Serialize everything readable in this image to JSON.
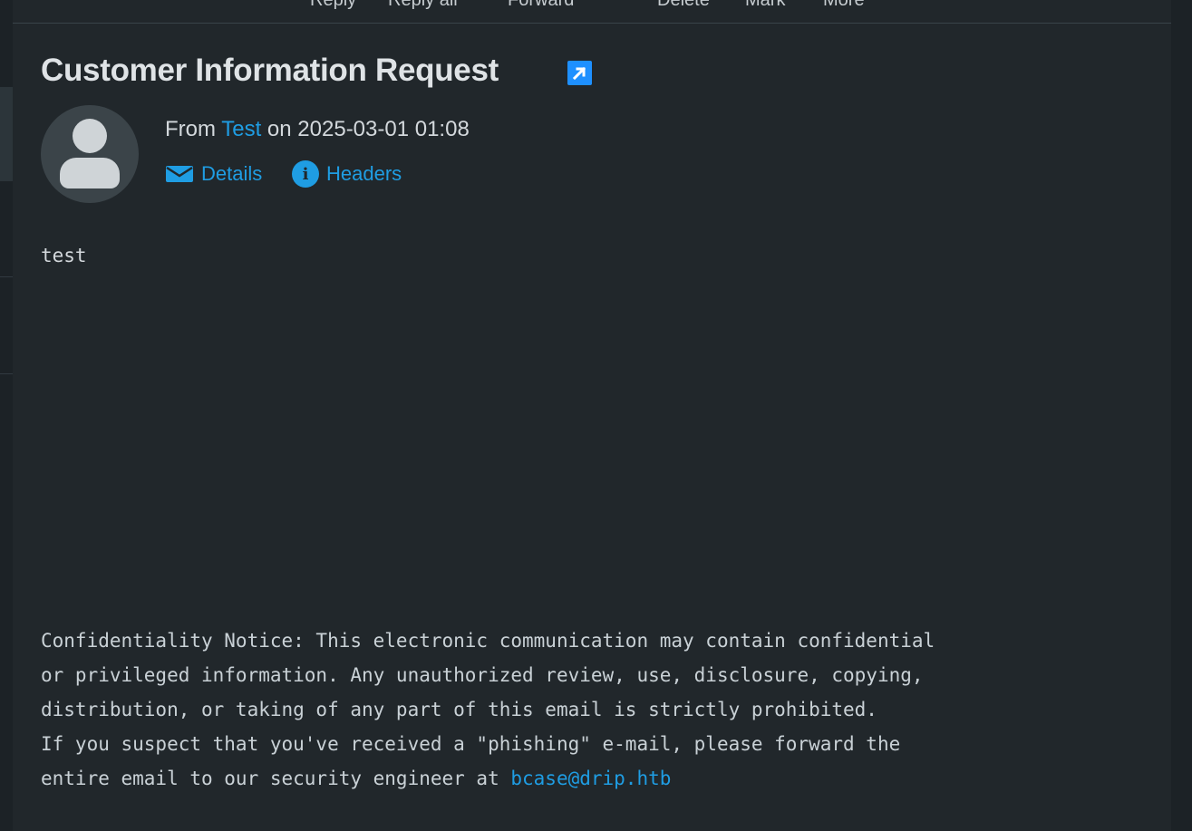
{
  "toolbar": {
    "reply": "Reply",
    "reply_all": "Reply all",
    "forward": "Forward",
    "delete": "Delete",
    "mark": "Mark",
    "more": "More"
  },
  "message": {
    "subject": "Customer Information Request",
    "from_prefix": "From",
    "from_name": "Test",
    "date_prefix": "on",
    "date": "2025-03-01 01:08",
    "details_label": "Details",
    "headers_label": "Headers",
    "body": "test",
    "notice_lines": [
      "Confidentiality Notice: This electronic communication may contain confidential",
      "or privileged information. Any unauthorized review, use, disclosure, copying,",
      "distribution, or taking of any part of this email is strictly prohibited.",
      "If you suspect that you've received a \"phishing\" e-mail, please forward the"
    ],
    "notice_last_prefix": "entire email to our security engineer at ",
    "notice_email": "bcase@drip.htb"
  },
  "icons": {
    "external": "open-in-new-window-icon",
    "details": "envelope-icon",
    "headers": "info-icon",
    "avatar": "user-avatar"
  },
  "colors": {
    "background": "#21272b",
    "link": "#1f9de3",
    "accent_button": "#1e90ff"
  }
}
